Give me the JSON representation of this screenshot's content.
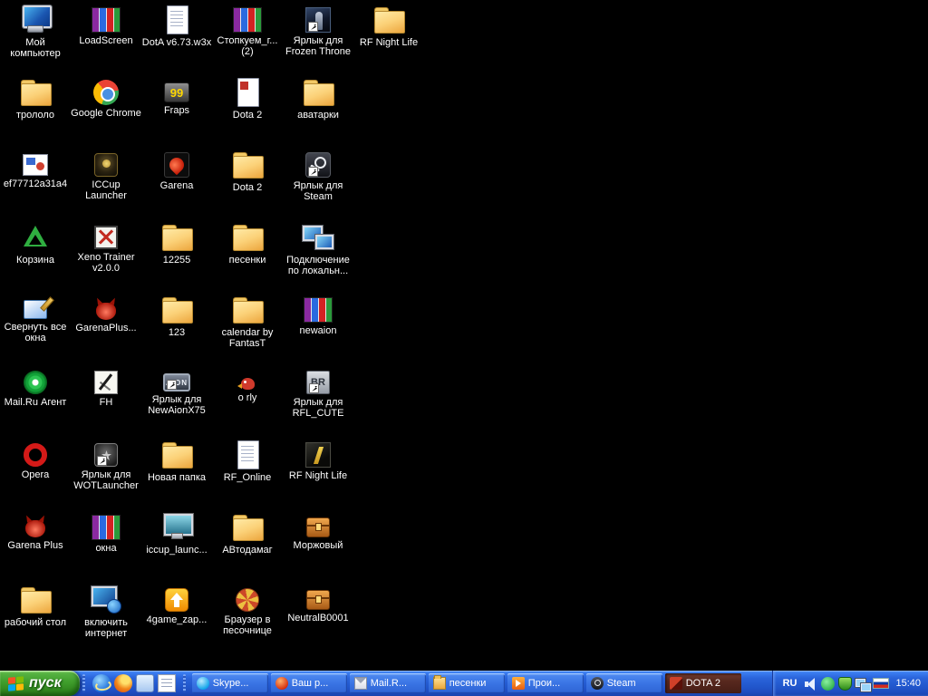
{
  "desktop": {
    "icons": [
      {
        "label": "Мой компьютер",
        "kind": "computer",
        "col": 0,
        "row": 0
      },
      {
        "label": "LoadScreen",
        "kind": "winrar",
        "col": 1,
        "row": 0
      },
      {
        "label": "DotA v6.73.w3x",
        "kind": "doc",
        "col": 2,
        "row": 0
      },
      {
        "label": "Стопкуем_г... (2)",
        "kind": "winrar",
        "col": 3,
        "row": 0
      },
      {
        "label": "Ярлык для Frozen Throne",
        "kind": "frozen",
        "col": 4,
        "row": 0,
        "shortcut": true
      },
      {
        "label": "RF Night Life",
        "kind": "folder",
        "col": 5,
        "row": 0
      },
      {
        "label": "трололо",
        "kind": "folder",
        "col": 0,
        "row": 1
      },
      {
        "label": "Google Chrome",
        "kind": "chrome",
        "col": 1,
        "row": 1
      },
      {
        "label": "Fraps",
        "kind": "fraps",
        "art_text": "99",
        "col": 2,
        "row": 1
      },
      {
        "label": "Dota 2",
        "kind": "doc2",
        "col": 3,
        "row": 1
      },
      {
        "label": "аватарки",
        "kind": "folder",
        "col": 4,
        "row": 1
      },
      {
        "label": "ef77712a31a4",
        "kind": "image",
        "col": 0,
        "row": 2
      },
      {
        "label": "ICCup Launcher",
        "kind": "iccup",
        "col": 1,
        "row": 2
      },
      {
        "label": "Garena",
        "kind": "garena",
        "col": 2,
        "row": 2
      },
      {
        "label": "Dota 2",
        "kind": "folder",
        "col": 3,
        "row": 2
      },
      {
        "label": "Ярлык для Steam",
        "kind": "steam",
        "col": 4,
        "row": 2,
        "shortcut": true
      },
      {
        "label": "Корзина",
        "kind": "recycle",
        "col": 0,
        "row": 3
      },
      {
        "label": "Xeno Trainer v2.0.0",
        "kind": "xeno",
        "col": 1,
        "row": 3
      },
      {
        "label": "12255",
        "kind": "folder",
        "col": 2,
        "row": 3
      },
      {
        "label": "песенки",
        "kind": "folder",
        "col": 3,
        "row": 3
      },
      {
        "label": "Подключение по локальн...",
        "kind": "network",
        "col": 4,
        "row": 3
      },
      {
        "label": "Свернуть все окна",
        "kind": "showdesk",
        "col": 0,
        "row": 4
      },
      {
        "label": "GarenaPlus...",
        "kind": "devil",
        "col": 1,
        "row": 4
      },
      {
        "label": "123",
        "kind": "folder",
        "col": 2,
        "row": 4
      },
      {
        "label": "calendar by FantasT",
        "kind": "folder",
        "col": 3,
        "row": 4
      },
      {
        "label": "newaion",
        "kind": "winrar",
        "col": 4,
        "row": 4
      },
      {
        "label": "Mail.Ru Агент",
        "kind": "mailru",
        "col": 0,
        "row": 5
      },
      {
        "label": "FH",
        "kind": "fh",
        "col": 1,
        "row": 5
      },
      {
        "label": "Ярлык для NewAionX75",
        "kind": "aion",
        "art_text": "AION",
        "col": 2,
        "row": 5,
        "shortcut": true
      },
      {
        "label": "o rly",
        "kind": "orly",
        "col": 3,
        "row": 5
      },
      {
        "label": "Ярлык для RFL_CUTE",
        "kind": "br",
        "art_text": "BR",
        "col": 4,
        "row": 5,
        "shortcut": true
      },
      {
        "label": "Opera",
        "kind": "opera",
        "col": 0,
        "row": 6
      },
      {
        "label": "Ярлык для WOTLauncher",
        "kind": "wot",
        "col": 1,
        "row": 6,
        "shortcut": true
      },
      {
        "label": "Новая папка",
        "kind": "folder",
        "col": 2,
        "row": 6
      },
      {
        "label": "RF_Online",
        "kind": "doc",
        "col": 3,
        "row": 6
      },
      {
        "label": "RF Night Life",
        "kind": "rfnl",
        "col": 4,
        "row": 6
      },
      {
        "label": "Garena Plus",
        "kind": "devil",
        "col": 0,
        "row": 7
      },
      {
        "label": "окна",
        "kind": "winrar",
        "col": 1,
        "row": 7
      },
      {
        "label": "iccup_launc...",
        "kind": "iccup2",
        "col": 2,
        "row": 7
      },
      {
        "label": "АВтодамаг",
        "kind": "folder",
        "col": 3,
        "row": 7
      },
      {
        "label": "Моржовый",
        "kind": "chest",
        "col": 4,
        "row": 7
      },
      {
        "label": "рабочий стол",
        "kind": "folder",
        "col": 0,
        "row": 8
      },
      {
        "label": "включить интернет",
        "kind": "netpc",
        "col": 1,
        "row": 8
      },
      {
        "label": "4game_zap...",
        "kind": "arrow4",
        "col": 2,
        "row": 8
      },
      {
        "label": "Браузер в песочнице",
        "kind": "sandbox",
        "col": 3,
        "row": 8
      },
      {
        "label": "NeutralB0001",
        "kind": "chest",
        "col": 4,
        "row": 8
      }
    ]
  },
  "taskbar": {
    "start_label": "пуск",
    "quick_launch": [
      {
        "name": "internet-explorer-icon",
        "kind": "ie"
      },
      {
        "name": "firefox-icon",
        "kind": "ff"
      },
      {
        "name": "media-player-icon",
        "kind": "md"
      },
      {
        "name": "notes-icon",
        "kind": "note"
      }
    ],
    "buttons": [
      {
        "label": "Skype...",
        "icon": "skype"
      },
      {
        "label": "Ваш р...",
        "icon": "orange"
      },
      {
        "label": "Mail.R...",
        "icon": "mail"
      },
      {
        "label": "песенки",
        "icon": "folder"
      },
      {
        "label": "Прои...",
        "icon": "player"
      },
      {
        "label": "Steam",
        "icon": "steam"
      },
      {
        "label": "DOTA 2",
        "icon": "dota",
        "active": true
      }
    ],
    "tray": {
      "language": "RU",
      "icons": [
        {
          "name": "volume-icon",
          "kind": "volume"
        },
        {
          "name": "mailru-agent-tray-icon",
          "kind": "agent"
        },
        {
          "name": "antivirus-shield-icon",
          "kind": "shield"
        },
        {
          "name": "network-status-icon",
          "kind": "network"
        },
        {
          "name": "russian-flag-icon",
          "kind": "flag"
        }
      ],
      "clock": "15:40"
    }
  },
  "colors": {
    "desktop_background": "#000000",
    "taskbar_blue": "#2a63da",
    "start_button_green": "#3f9e2c",
    "taskbar_button_blue": "#3a74e4",
    "active_button_maroon": "#57281e",
    "folder_yellow": "#fbd178",
    "label_text": "#ffffff"
  }
}
